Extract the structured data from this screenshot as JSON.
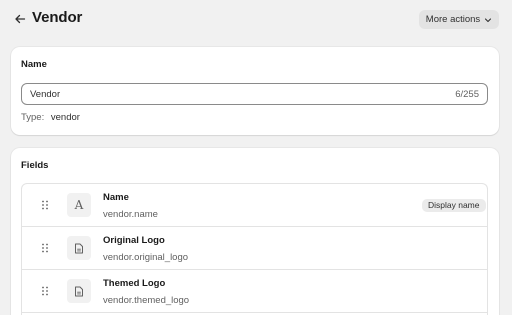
{
  "header": {
    "title": "Vendor",
    "more_actions_label": "More actions"
  },
  "name_card": {
    "title": "Name",
    "input_value": "Vendor",
    "char_count": "6/255",
    "type_label": "Type:",
    "type_value": "vendor"
  },
  "fields_card": {
    "title": "Fields",
    "rows": [
      {
        "label": "Name",
        "key": "vendor.name",
        "icon": "text-icon",
        "icon_glyph": "A",
        "badge": "Display name"
      },
      {
        "label": "Original Logo",
        "key": "vendor.original_logo",
        "icon": "file-icon"
      },
      {
        "label": "Themed Logo",
        "key": "vendor.themed_logo",
        "icon": "file-icon"
      }
    ]
  }
}
